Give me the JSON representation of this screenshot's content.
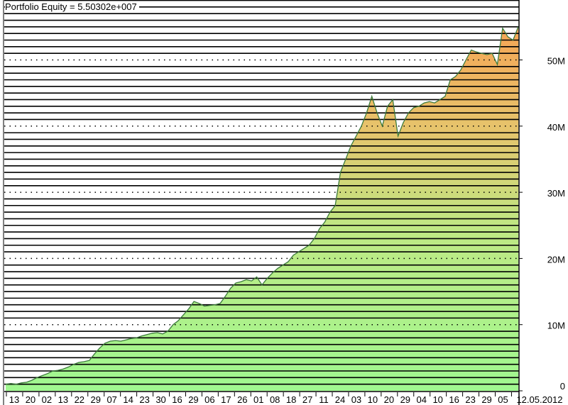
{
  "chart_data": {
    "type": "area",
    "title": "Portfolio Equity = 5.50302e+007",
    "xlabel": "",
    "ylabel": "",
    "ylim": [
      0,
      59
    ],
    "y_unit": "M",
    "y_ticks": [
      {
        "value": 0,
        "label": "0"
      },
      {
        "value": 10,
        "label": "10M"
      },
      {
        "value": 20,
        "label": "20M"
      },
      {
        "value": 30,
        "label": "30M"
      },
      {
        "value": 40,
        "label": "40M"
      },
      {
        "value": 50,
        "label": "50M"
      }
    ],
    "x_tick_labels": [
      "13",
      "20",
      "02",
      "13",
      "22",
      "29",
      "07",
      "14",
      "23",
      "30",
      "16",
      "29",
      "06",
      "17",
      "26",
      "01",
      "08",
      "18",
      "27",
      "11",
      "24",
      "03",
      "10",
      "20",
      "29",
      "04",
      "10",
      "16",
      "23",
      "29",
      "05",
      "12.05.2012"
    ],
    "grid": true,
    "fill_colors": {
      "low": "#a0f890",
      "mid": "#c8dc78",
      "high": "#f0a858"
    },
    "line_color": "#3c7a3c",
    "series": [
      {
        "name": "Portfolio Equity (M)",
        "values": [
          1.0,
          1.1,
          1.0,
          1.2,
          1.3,
          1.6,
          2.0,
          2.3,
          2.6,
          3.0,
          3.1,
          3.3,
          3.6,
          4.0,
          4.3,
          4.4,
          4.6,
          5.6,
          6.5,
          7.2,
          7.5,
          7.6,
          7.5,
          7.7,
          7.9,
          8.0,
          8.3,
          8.5,
          8.7,
          8.8,
          8.6,
          9.0,
          10.0,
          10.6,
          11.5,
          12.4,
          13.5,
          13.2,
          12.8,
          12.9,
          13.0,
          13.2,
          14.3,
          15.5,
          16.3,
          16.5,
          16.8,
          16.6,
          17.2,
          16.0,
          17.0,
          17.8,
          18.5,
          19.0,
          19.5,
          20.5,
          21.0,
          21.5,
          22.0,
          23.0,
          24.5,
          25.5,
          27.0,
          28.0,
          33.0,
          35.0,
          37.0,
          38.5,
          40.0,
          42.0,
          44.5,
          42.0,
          40.0,
          43.0,
          44.0,
          38.5,
          40.5,
          42.0,
          42.8,
          43.0,
          43.5,
          43.7,
          43.5,
          44.0,
          44.5,
          47.0,
          47.5,
          48.5,
          50.0,
          51.5,
          51.2,
          51.0,
          50.8,
          51.0,
          49.3,
          54.8,
          53.5,
          53.0,
          55.03
        ]
      }
    ]
  }
}
